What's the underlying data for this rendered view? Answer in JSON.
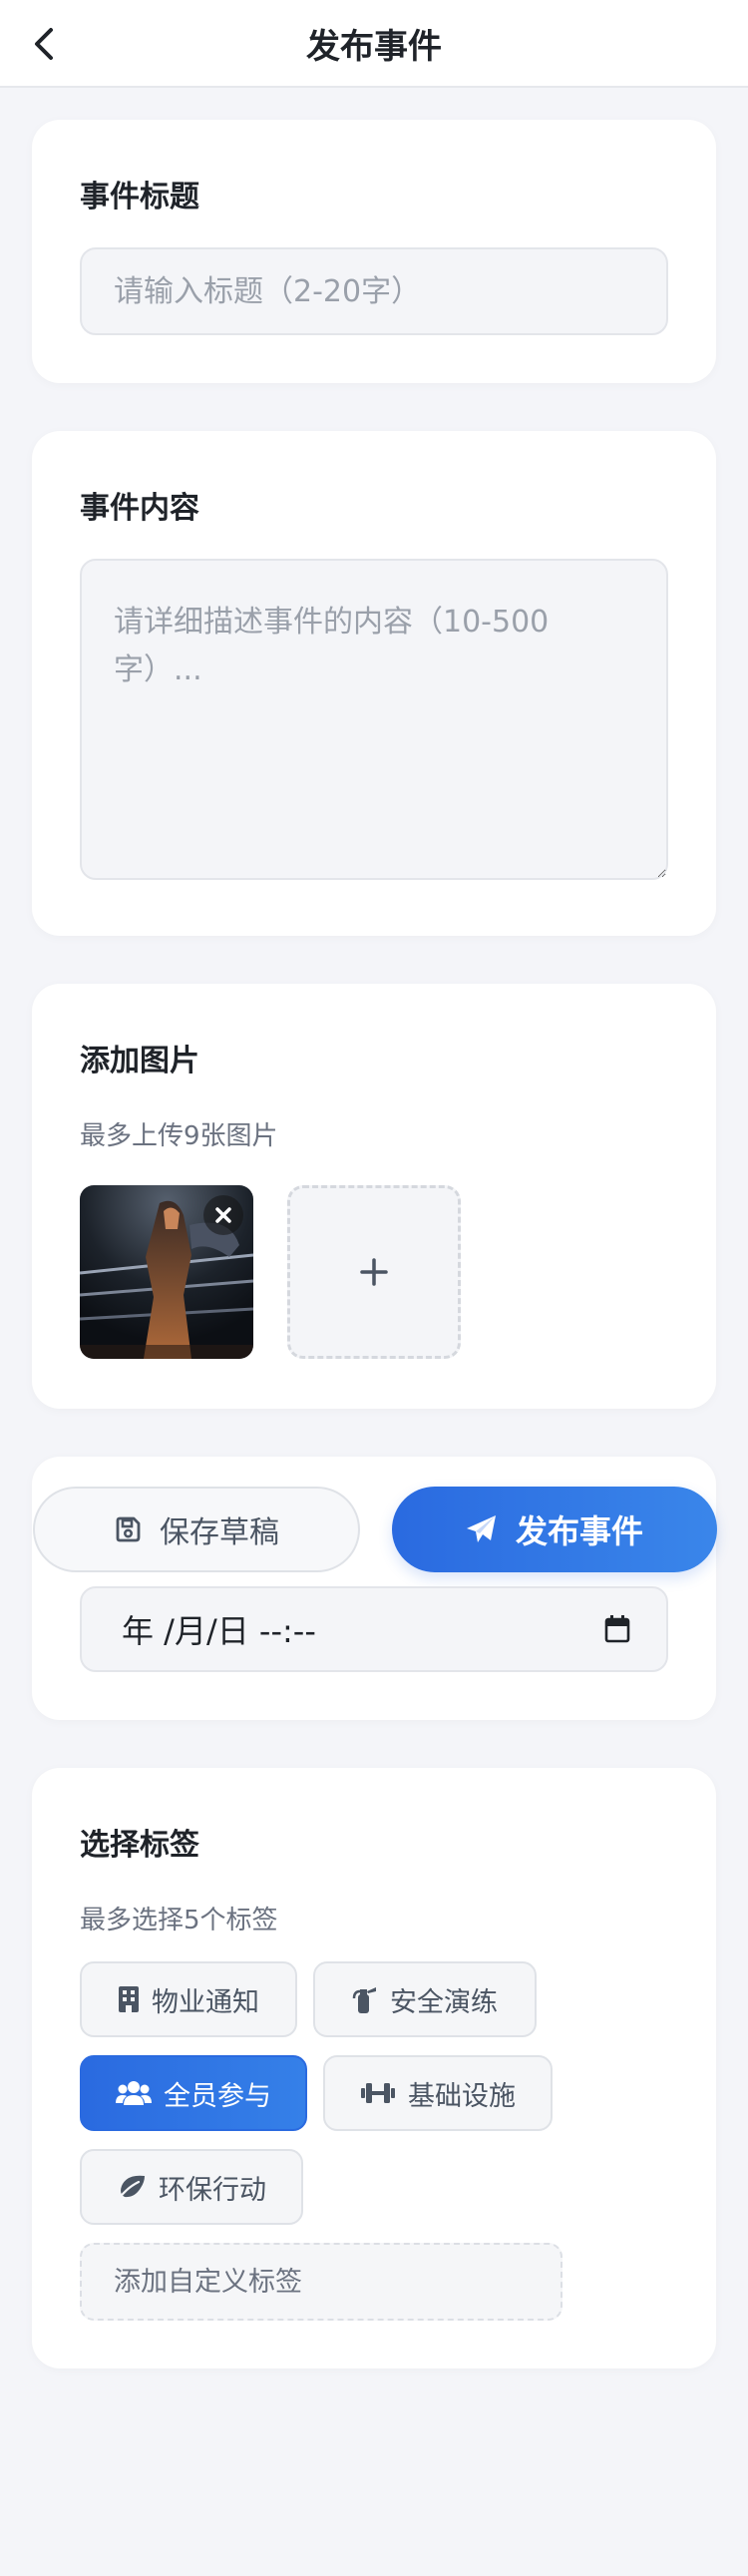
{
  "header": {
    "title": "发布事件"
  },
  "event_title": {
    "label": "事件标题",
    "placeholder": "请输入标题（2-20字）",
    "value": ""
  },
  "event_content": {
    "label": "事件内容",
    "placeholder": "请详细描述事件的内容（10-500字）...",
    "value": ""
  },
  "images": {
    "label": "添加图片",
    "hint": "最多上传9张图片",
    "add_icon": "plus-icon",
    "remove_icon": "close-icon"
  },
  "actions": {
    "draft_label": "保存草稿",
    "publish_label": "发布事件",
    "draft_icon": "save-icon",
    "publish_icon": "paper-plane-icon"
  },
  "date": {
    "value": "年 /月/日 --:--",
    "icon": "calendar-icon"
  },
  "tags": {
    "label": "选择标签",
    "hint": "最多选择5个标签",
    "items": [
      {
        "label": "物业通知",
        "icon": "building-icon",
        "selected": false
      },
      {
        "label": "安全演练",
        "icon": "fire-extinguisher-icon",
        "selected": false
      },
      {
        "label": "全员参与",
        "icon": "users-icon",
        "selected": true
      },
      {
        "label": "基础设施",
        "icon": "dumbbell-icon",
        "selected": false
      },
      {
        "label": "环保行动",
        "icon": "leaf-icon",
        "selected": false
      }
    ],
    "custom_placeholder": "添加自定义标签"
  },
  "colors": {
    "accent": "#2a6ae0",
    "background": "#f4f5f9",
    "card": "#ffffff"
  }
}
